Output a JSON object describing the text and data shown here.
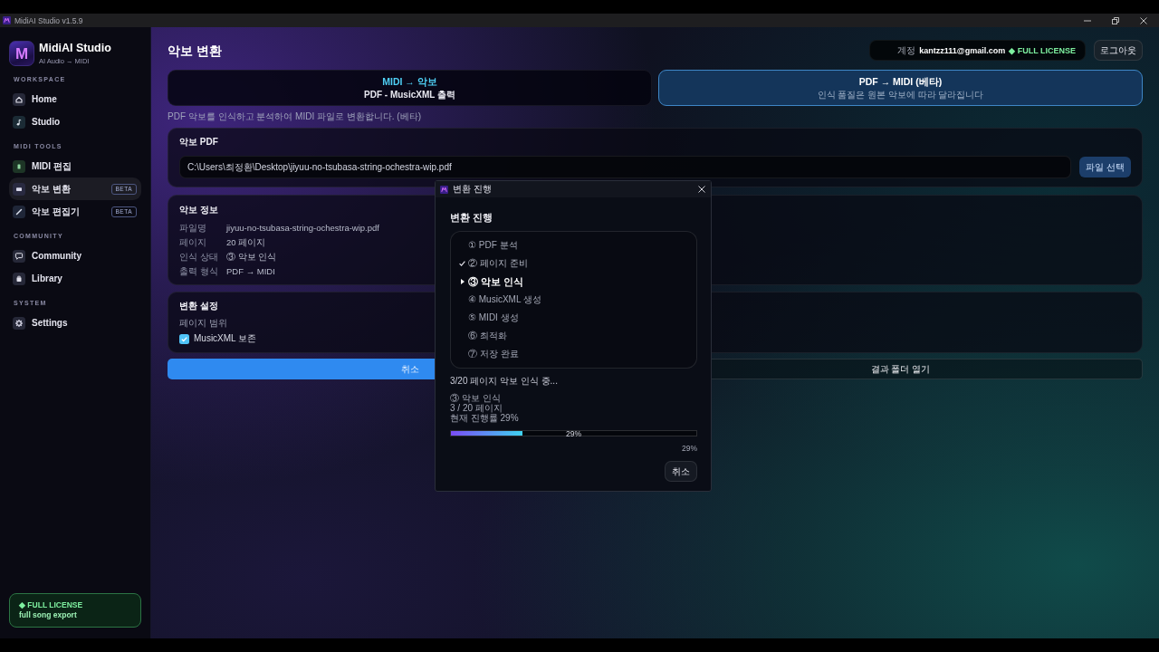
{
  "window": {
    "title": "MidiAI Studio v1.5.9"
  },
  "sidebar": {
    "logo_text": "M",
    "app_name": "MidiAI Studio",
    "tagline": "AI Audio → MIDI",
    "sections": [
      {
        "heading": "WORKSPACE",
        "items": [
          {
            "label": "Home",
            "selected": false
          },
          {
            "label": "Studio",
            "selected": false
          }
        ]
      },
      {
        "heading": "MIDI TOOLS",
        "items": [
          {
            "label": "MIDI 편집",
            "selected": false
          },
          {
            "label": "악보 변환",
            "selected": true,
            "badge": "BETA"
          },
          {
            "label": "악보 편집기",
            "selected": false,
            "badge": "BETA"
          }
        ]
      },
      {
        "heading": "COMMUNITY",
        "items": [
          {
            "label": "Community",
            "selected": false
          },
          {
            "label": "Library",
            "selected": false
          }
        ]
      },
      {
        "heading": "SYSTEM",
        "items": [
          {
            "label": "Settings",
            "selected": false
          }
        ]
      }
    ],
    "license_card": {
      "title": "◆ FULL LICENSE",
      "subtitle": "full song export"
    }
  },
  "header": {
    "page_title": "악보 변환",
    "account": {
      "label": "계정",
      "email": "kantzz111@gmail.com",
      "license": "◆ FULL LICENSE"
    },
    "logout_button": "로그아웃"
  },
  "mode_tabs": [
    {
      "title": "MIDI → 악보",
      "subtitle": "PDF - MusicXML 출력",
      "selected": false
    },
    {
      "title": "PDF → MIDI (베타)",
      "subtitle": "인식 품질은 원본 악보에 따라 달라집니다",
      "selected": true
    }
  ],
  "description": "PDF 악보를 인식하고 분석하여 MIDI 파일로 변환합니다. (베타)",
  "pdf_card": {
    "title": "악보 PDF",
    "path": "C:\\Users\\최정환\\Desktop\\jiyuu-no-tsubasa-string-ochestra-wip.pdf",
    "button": "파일 선택"
  },
  "info_card": {
    "title": "악보 정보",
    "rows": [
      {
        "label": "파일명",
        "value": "jiyuu-no-tsubasa-string-ochestra-wip.pdf"
      },
      {
        "label": "페이지",
        "value": "20 페이지"
      },
      {
        "label": "인식 상태",
        "value": "③ 악보 인식"
      },
      {
        "label": "출력 형식",
        "value": "PDF → MIDI"
      }
    ]
  },
  "settings_card": {
    "title": "변환 설정",
    "page_range_label": "페이지 범위",
    "options": [
      {
        "label": "MusicXML 보존",
        "checked": true
      }
    ]
  },
  "actions": [
    {
      "label": "취소",
      "kind": "primary"
    },
    {
      "label": "결과 폴더 열기",
      "kind": "secondary"
    }
  ],
  "dialog": {
    "title": "변환 진행",
    "heading": "변환 진행",
    "steps": [
      {
        "label": "① PDF 분석",
        "done": false,
        "current": false
      },
      {
        "label": "② 페이지 준비",
        "done": true,
        "current": false
      },
      {
        "label": "③ 악보 인식",
        "done": false,
        "current": true
      },
      {
        "label": "④ MusicXML 생성",
        "done": false,
        "current": false
      },
      {
        "label": "⑤ MIDI 생성",
        "done": false,
        "current": false
      },
      {
        "label": "⑥ 최적화",
        "done": false,
        "current": false
      },
      {
        "label": "⑦ 저장 완료",
        "done": false,
        "current": false
      }
    ],
    "status_text": "3/20 페이지 악보 인식 중...",
    "details": [
      "③ 악보 인식",
      "3 / 20 페이지",
      "현재 진행률 29%"
    ],
    "progress": {
      "level": 0.29,
      "label": "29%",
      "reading": "29%"
    },
    "cancel_button": "취소"
  }
}
